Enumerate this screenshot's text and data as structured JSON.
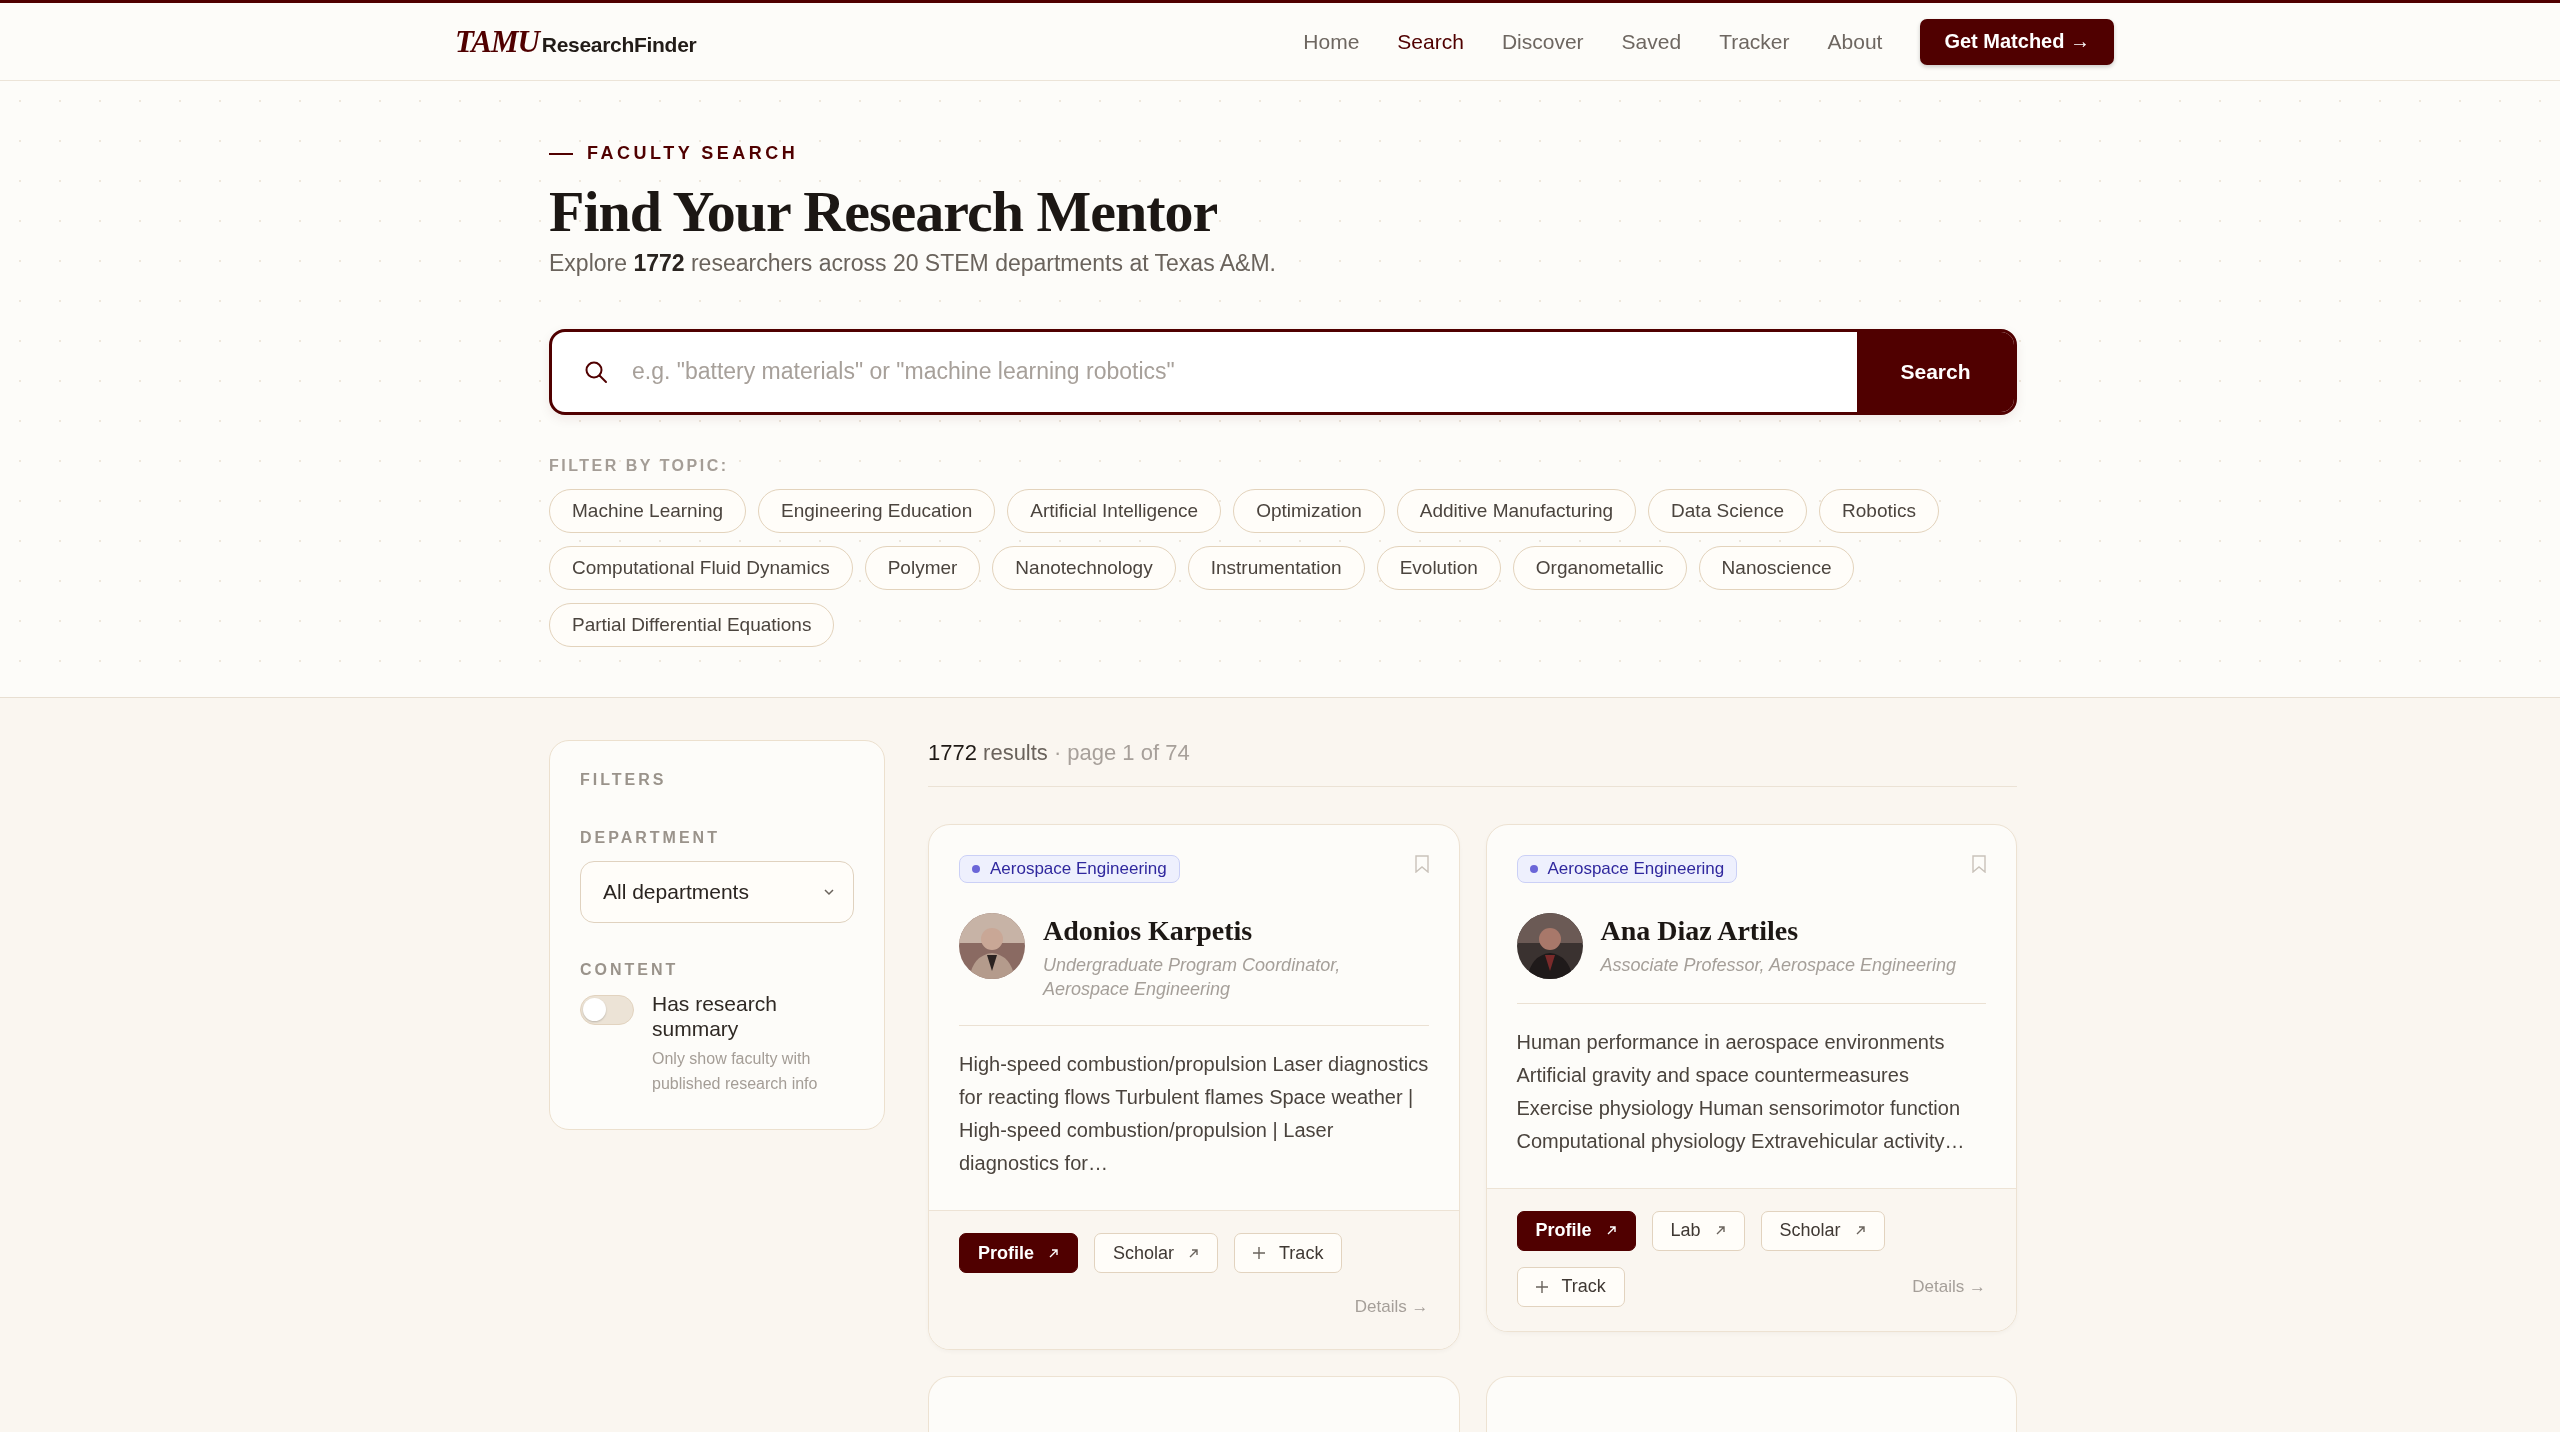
{
  "header": {
    "logo_mark": "TAMU",
    "logo_text": "ResearchFinder",
    "nav": [
      {
        "label": "Home",
        "selected": false
      },
      {
        "label": "Search",
        "selected": true
      },
      {
        "label": "Discover",
        "selected": false
      },
      {
        "label": "Saved",
        "selected": false
      },
      {
        "label": "Tracker",
        "selected": false
      },
      {
        "label": "About",
        "selected": false
      }
    ],
    "cta": "Get Matched →"
  },
  "hero": {
    "eyebrow": "FACULTY SEARCH",
    "title": "Find Your Research Mentor",
    "subtitle": "Explore **1772** researchers across 20 STEM departments at Texas A&M.",
    "search": {
      "placeholder": "e.g. \"battery materials\" or \"machine learning robotics\"",
      "button": "Search"
    },
    "topics_label": "FILTER BY TOPIC:",
    "topics": [
      "Machine Learning",
      "Engineering Education",
      "Artificial Intelligence",
      "Optimization",
      "Additive Manufacturing",
      "Data Science",
      "Robotics",
      "Computational Fluid Dynamics",
      "Polymer",
      "Nanotechnology",
      "Instrumentation",
      "Evolution",
      "Organometallic",
      "Nanoscience",
      "Partial Differential Equations"
    ]
  },
  "filters": {
    "title": "FILTERS",
    "department_label": "DEPARTMENT",
    "department_value": "All departments",
    "content_label": "CONTENT",
    "toggle": {
      "label": "Has research summary",
      "hint": "Only show faculty with published research info",
      "on": false
    }
  },
  "results": {
    "count": "**1772** results",
    "page": "· page 1 of 74",
    "cards": [
      {
        "department": "Aerospace Engineering",
        "color": "#6b66d8",
        "name": "Adonios Karpetis",
        "title": "Undergraduate Program Coordinator, Aerospace Engineering",
        "summary": "High-speed combustion/propulsion Laser diagnostics for reacting flows Turbulent flames Space weather | High-speed combustion/propulsion | Laser diagnostics for…",
        "saved": false,
        "links": [
          {
            "label": "Profile",
            "kind": "primary"
          },
          {
            "label": "Scholar",
            "kind": "external"
          },
          {
            "label": "Track",
            "kind": "track"
          }
        ],
        "details": "Details →"
      },
      {
        "department": "Aerospace Engineering",
        "color": "#6b66d8",
        "name": "Ana Diaz Artiles",
        "title": "Associate Professor, Aerospace Engineering",
        "summary": "Human performance in aerospace environments Artificial gravity and space countermeasures Exercise physiology Human sensorimotor function Computational physiology Extravehicular activity…",
        "saved": false,
        "links": [
          {
            "label": "Profile",
            "kind": "primary"
          },
          {
            "label": "Lab",
            "kind": "external"
          },
          {
            "label": "Scholar",
            "kind": "external"
          },
          {
            "label": "Track",
            "kind": "track"
          }
        ],
        "details": "Details →"
      }
    ]
  }
}
